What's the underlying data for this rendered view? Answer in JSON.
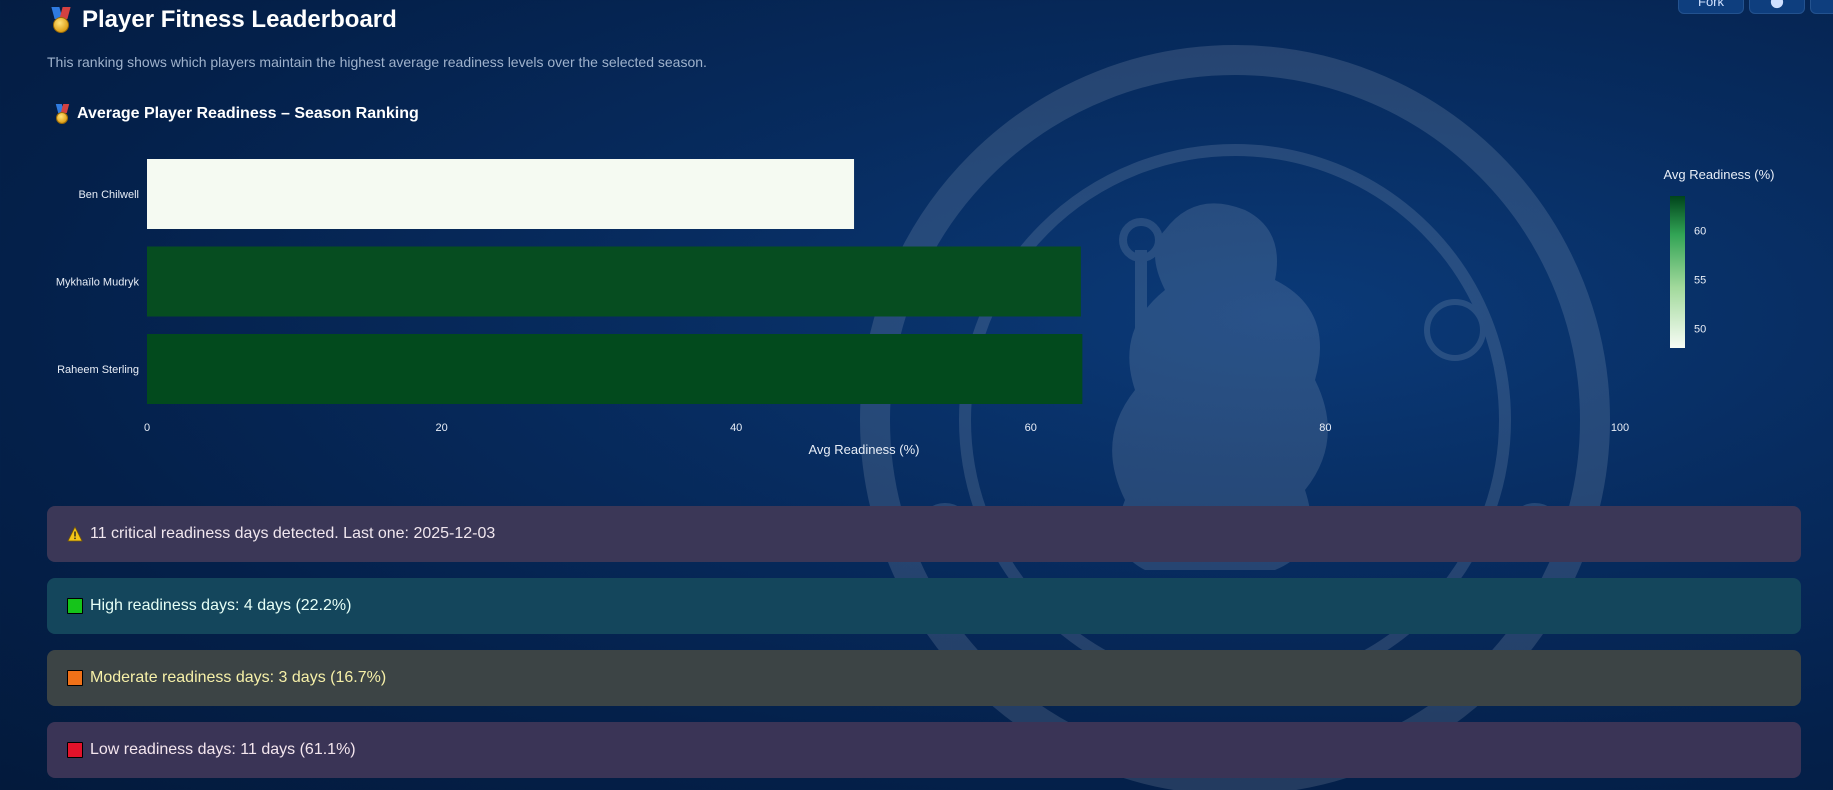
{
  "header": {
    "title": "Player Fitness Leaderboard",
    "subtitle": "This ranking shows which players maintain the highest average readiness levels over the selected season.",
    "buttons": {
      "fork_label": "Fork"
    }
  },
  "chart_section": {
    "title": "Average Player Readiness – Season Ranking"
  },
  "chart_data": {
    "type": "bar",
    "orientation": "horizontal",
    "categories": [
      "Ben Chilwell",
      "Mykhaïlo Mudryk",
      "Raheem Sterling"
    ],
    "values": [
      48,
      63.4,
      63.5
    ],
    "xlabel": "Avg Readiness (%)",
    "ylabel": "",
    "xlim": [
      0,
      100
    ],
    "xticks": [
      0,
      20,
      40,
      60,
      80,
      100
    ],
    "colorbar": {
      "title": "Avg Readiness (%)",
      "ticks": [
        50,
        55,
        60
      ],
      "range": [
        48,
        63.5
      ],
      "colors": [
        "#f7fcf5",
        "#00441b"
      ]
    },
    "bar_colors": [
      "#f5faf2",
      "#064d20",
      "#024a1d"
    ]
  },
  "alerts": [
    {
      "type": "warning",
      "text": "11 critical readiness days detected. Last one: 2025-12-03"
    },
    {
      "type": "high",
      "color": "#15c41a",
      "text": "High readiness days: 4 days (22.2%)"
    },
    {
      "type": "moderate",
      "color": "#f07118",
      "text": "Moderate readiness days: 3 days (16.7%)"
    },
    {
      "type": "low",
      "color": "#e3122a",
      "text": "Low readiness days: 11 days (61.1%)"
    }
  ]
}
